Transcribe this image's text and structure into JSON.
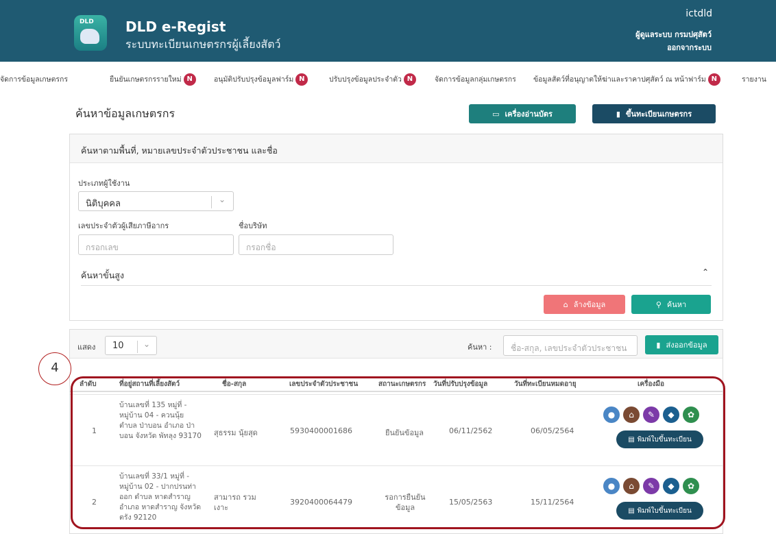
{
  "header": {
    "logo_text": "DLD",
    "title": "DLD e-Regist",
    "subtitle": "ระบบทะเบียนเกษตรกรผู้เลี้ยงสัตว์",
    "username": "ictdld",
    "role": "ผู้ดูแลระบบ กรมปศุสัตว์",
    "logout": "ออกจากระบบ",
    "color": "#1f5a72"
  },
  "nav": {
    "items": [
      {
        "label": "จัดการข้อมูลเกษตรกร",
        "badge": ""
      },
      {
        "label": "ยืนยันเกษตรกรรายใหม่",
        "badge": "N"
      },
      {
        "label": "อนุมัติปรับปรุงข้อมูลฟาร์ม",
        "badge": "N"
      },
      {
        "label": "ปรับปรุงข้อมูลประจำตัว",
        "badge": "N"
      },
      {
        "label": "จัดการข้อมูลกลุ่มเกษตรกร",
        "badge": ""
      },
      {
        "label": "ข้อมูลสัตว์ที่อนุญาตให้ฆ่าและราคาปศุสัตว์ ณ หน้าฟาร์ม",
        "badge": "N"
      },
      {
        "label": "รายงาน",
        "badge": ""
      }
    ]
  },
  "page": {
    "title": "ค้นหาข้อมูลเกษตรกร",
    "card_reader_button": "เครื่องอ่านบัตร",
    "register_button": "ขึ้นทะเบียนเกษตรกร"
  },
  "search": {
    "panel_title": "ค้นหาตามพื้นที่, หมายเลขประจำตัวประชาชน และชื่อ",
    "user_type_label": "ประเภทผู้ใช้งาน",
    "user_type_value": "นิติบุคคล",
    "tax_id_label": "เลขประจำตัวผู้เสียภาษีอากร",
    "tax_id_placeholder": "กรอกเลข",
    "company_label": "ชื่อบริษัท",
    "company_placeholder": "กรอกชื่อ",
    "advanced_label": "ค้นหาขั้นสูง",
    "clear_button": "ล้างข้อมูล",
    "search_button": "ค้นหา",
    "clear_color": "#f07578",
    "search_color": "#1aa38f"
  },
  "results": {
    "show_label": "แสดง",
    "page_size": "10",
    "search_label": "ค้นหา :",
    "search_placeholder": "ชื่อ-สกุล, เลขประจำตัวประชาชน",
    "export_button": "ส่งออกข้อมูล",
    "columns": [
      "ลำดับ",
      "ที่อยู่สถานที่เลี้ยงสัตว์",
      "ชื่อ-สกุล",
      "เลขประจำตัวประชาชน",
      "สถานะเกษตรกร",
      "วันที่ปรับปรุงข้อมูล",
      "วันที่ทะเบียนหมดอายุ",
      "เครื่องมือ"
    ],
    "rows": [
      {
        "no": "1",
        "address": "บ้านเลขที่ 135 หมู่ที่ - หมู่บ้าน 04 - ควนนุ้ย ตำบล ป่าบอน อำเภอ ป่าบอน จังหวัด พัทลุง 93170",
        "name": "สุธรรม นุ้ยสุด",
        "citizen_id": "5930400001686",
        "status": "ยืนยันข้อมูล",
        "updated": "06/11/2562",
        "expires": "06/05/2564",
        "print": "พิมพ์ใบขึ้นทะเบียน"
      },
      {
        "no": "2",
        "address": "บ้านเลขที่ 33/1 หมู่ที่ - หมู่บ้าน 02 - ปากปรนท่าออก ตำบล หาดสำราญ อำเภอ หาดสำราญ จังหวัด ตรัง 92120",
        "name": "สามารถ รวมเงาะ",
        "citizen_id": "3920400064479",
        "status": "รอการยืนยันข้อมูล",
        "updated": "15/05/2563",
        "expires": "15/11/2564",
        "print": "พิมพ์ใบขึ้นทะเบียน"
      }
    ],
    "tool_icons": [
      "user-icon",
      "farm-icon",
      "pencil-icon",
      "livestock-icon",
      "plant-icon"
    ],
    "tool_colors": [
      "#4a86c5",
      "#7a4a33",
      "#7c3aa8",
      "#1b5f8f",
      "#2f8f4f"
    ]
  },
  "annotation": {
    "number": "4"
  }
}
